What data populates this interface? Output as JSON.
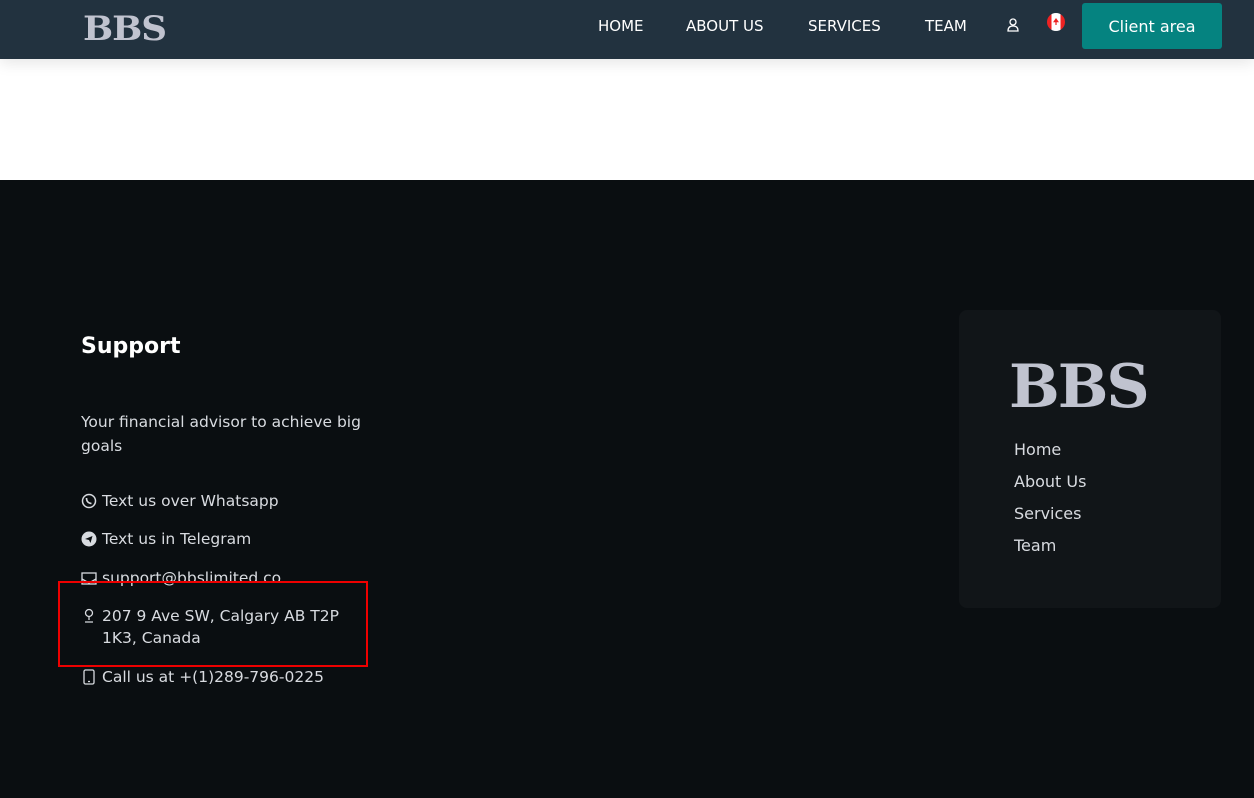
{
  "header": {
    "logo": "BBS",
    "nav": [
      "HOME",
      "ABOUT US",
      "SERVICES",
      "TEAM"
    ],
    "client_area": "Client area"
  },
  "footer": {
    "support_title": "Support",
    "tagline": "Your financial advisor to achieve big goals",
    "contacts": {
      "whatsapp": "Text us over Whatsapp",
      "telegram": "Text us in Telegram",
      "email": "support@bbslimited.co",
      "address": "207 9 Ave SW, Calgary AB T2P 1K3, Canada",
      "phone": "Call us at +(1)289-796-0225"
    },
    "card": {
      "logo": "BBS",
      "links": [
        "Home",
        "About Us",
        "Services",
        "Team"
      ]
    }
  }
}
